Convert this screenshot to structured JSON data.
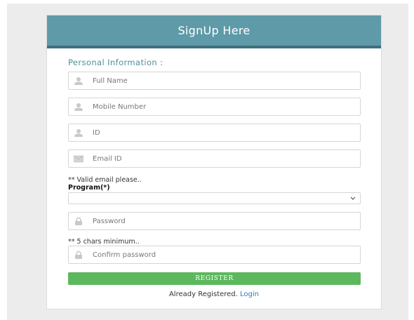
{
  "header": {
    "title": "SignUp Here"
  },
  "section": {
    "title": "Personal Information :"
  },
  "fields": {
    "full_name": {
      "placeholder": "Full Name",
      "value": "",
      "icon": "user-icon"
    },
    "mobile": {
      "placeholder": "Mobile Number",
      "value": "",
      "icon": "user-icon"
    },
    "id": {
      "placeholder": "ID",
      "value": "",
      "icon": "user-icon"
    },
    "email": {
      "placeholder": "Email ID",
      "value": "",
      "icon": "envelope-icon"
    },
    "password": {
      "placeholder": "Password",
      "value": "",
      "icon": "lock-icon"
    },
    "confirm_password": {
      "placeholder": "Confirm password",
      "value": "",
      "icon": "lock-icon"
    }
  },
  "hints": {
    "email": "** Valid email please..",
    "password": "** 5 chars minimum.."
  },
  "program": {
    "label": "Program(*)",
    "selected": ""
  },
  "register": {
    "label": "REGISTER"
  },
  "footer": {
    "text": "Already Registered.",
    "link": "Login"
  },
  "colors": {
    "header_bg": "#5f9aa8",
    "header_border": "#3d6f7c",
    "section_title": "#4f8d9b",
    "register_bg": "#5cb85c",
    "link": "#2c7fb8"
  }
}
